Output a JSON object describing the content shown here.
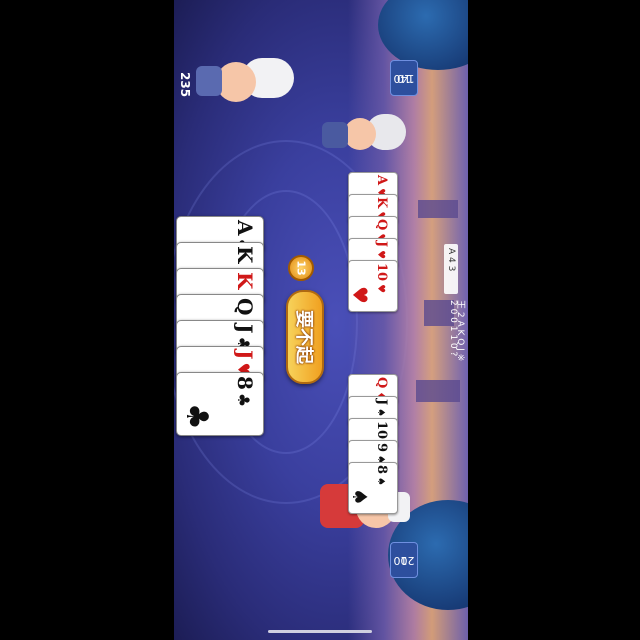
{
  "game": {
    "my_points": "235",
    "cards_left_badge": "13",
    "pass_label": "要不起"
  },
  "opponent_top": {
    "score_top": "140",
    "score_bottom": "10",
    "played_cards": [
      {
        "rank": "A",
        "suit": "♥",
        "color": "#d01818"
      },
      {
        "rank": "K",
        "suit": "♥",
        "color": "#d01818"
      },
      {
        "rank": "Q",
        "suit": "♥",
        "color": "#d01818"
      },
      {
        "rank": "J",
        "suit": "♥",
        "color": "#d01818"
      },
      {
        "rank": "10",
        "suit": "♥",
        "color": "#d01818"
      }
    ]
  },
  "opponent_bottom": {
    "score_top": "200",
    "score_bottom": "1",
    "played_cards": [
      {
        "rank": "Q",
        "suit": "♦",
        "color": "#d01818"
      },
      {
        "rank": "J",
        "suit": "♠",
        "color": "#111111"
      },
      {
        "rank": "10",
        "suit": "♣",
        "color": "#111111"
      },
      {
        "rank": "9",
        "suit": "♠",
        "color": "#111111"
      },
      {
        "rank": "8",
        "suit": "♠",
        "color": "#111111"
      }
    ]
  },
  "my_hand": [
    {
      "rank": "A",
      "suit": "♣",
      "color": "#111111"
    },
    {
      "rank": "K",
      "suit": "♣",
      "color": "#111111"
    },
    {
      "rank": "K",
      "suit": "♦",
      "color": "#d01818"
    },
    {
      "rank": "Q",
      "suit": "♣",
      "color": "#111111"
    },
    {
      "rank": "J",
      "suit": "♣",
      "color": "#111111"
    },
    {
      "rank": "J",
      "suit": "♥",
      "color": "#d01818"
    },
    {
      "rank": "8",
      "suit": "♣",
      "color": "#111111"
    }
  ],
  "card_tracker": {
    "header": [
      "A",
      "4",
      "3"
    ],
    "ranks": "王 2 A K Q J ※",
    "counts": "2 0 0 1 1 0 ?"
  },
  "colors": {
    "accent": "#f0a020",
    "table": "#3a3f9e",
    "red_suit": "#d01818"
  }
}
